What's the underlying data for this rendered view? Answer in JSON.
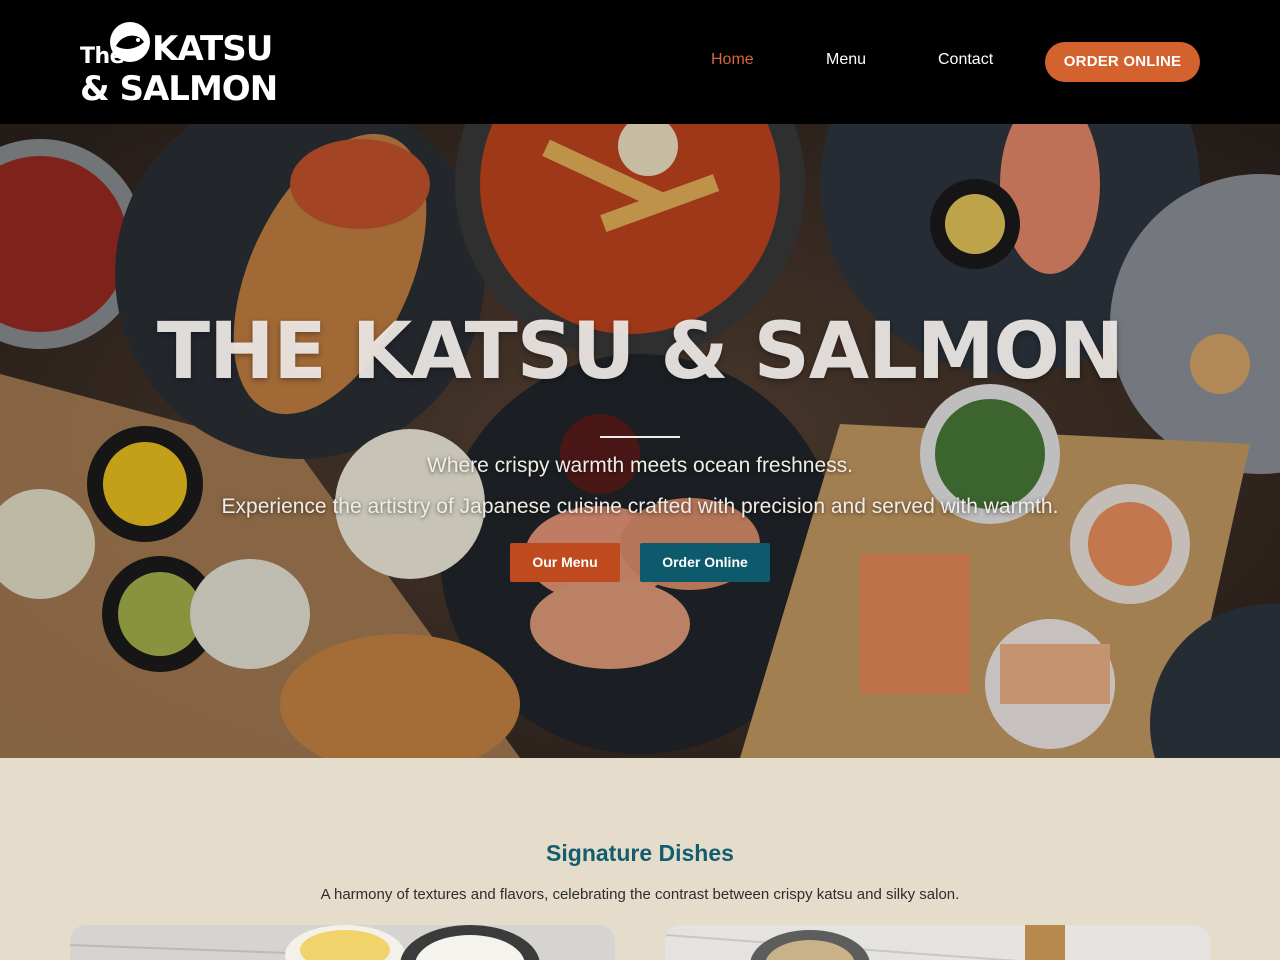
{
  "header": {
    "logo_the": "The",
    "logo_line1": "KATSU",
    "logo_line2": "& SALMON",
    "nav": [
      {
        "label": "Home",
        "active": true
      },
      {
        "label": "Menu",
        "active": false
      },
      {
        "label": "Contact",
        "active": false
      }
    ],
    "order_button": "ORDER ONLINE"
  },
  "hero": {
    "title": "THE KATSU & SALMON",
    "subtitle_line1": "Where crispy warmth meets ocean freshness.",
    "subtitle_line2": "Experience the artistry of Japanese cuisine crafted with precision and served with warmth.",
    "button_menu": "Our Menu",
    "button_order": "Order Online"
  },
  "signature": {
    "title": "Signature Dishes",
    "description": "A harmony of textures and flavors, celebrating the contrast between crispy katsu and silky salon."
  },
  "colors": {
    "accent_orange": "#d4622f",
    "teal": "#135e6d",
    "page_bg": "#e6dccc",
    "header_bg": "#000000"
  }
}
